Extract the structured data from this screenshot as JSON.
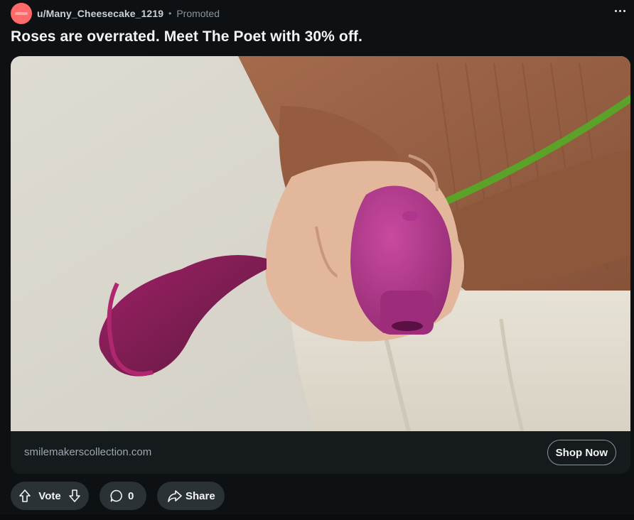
{
  "post": {
    "username": "u/Many_Cheesecake_1219",
    "separator": "•",
    "promoted_label": "Promoted",
    "title": "Roses are overrated. Meet The Poet with 30% off.",
    "avatar_color": "#ff6969"
  },
  "ad": {
    "domain": "smilemakerscollection.com",
    "cta_label": "Shop Now"
  },
  "actions": {
    "vote_label": "Vote",
    "comment_count": "0",
    "share_label": "Share"
  },
  "icons": {
    "more": "more-horizontal-icon",
    "upvote": "arrow-up-icon",
    "downvote": "arrow-down-icon",
    "comment": "comment-bubble-icon",
    "share": "share-arrow-icon"
  },
  "colors": {
    "background": "#0e1113",
    "pill": "#2a3236",
    "text": "#f2f4f5",
    "muted": "#8a949b",
    "product": "#b23b8e",
    "flower": "#8a1f5a",
    "stem": "#5aa228",
    "sweater": "#9c6446"
  }
}
